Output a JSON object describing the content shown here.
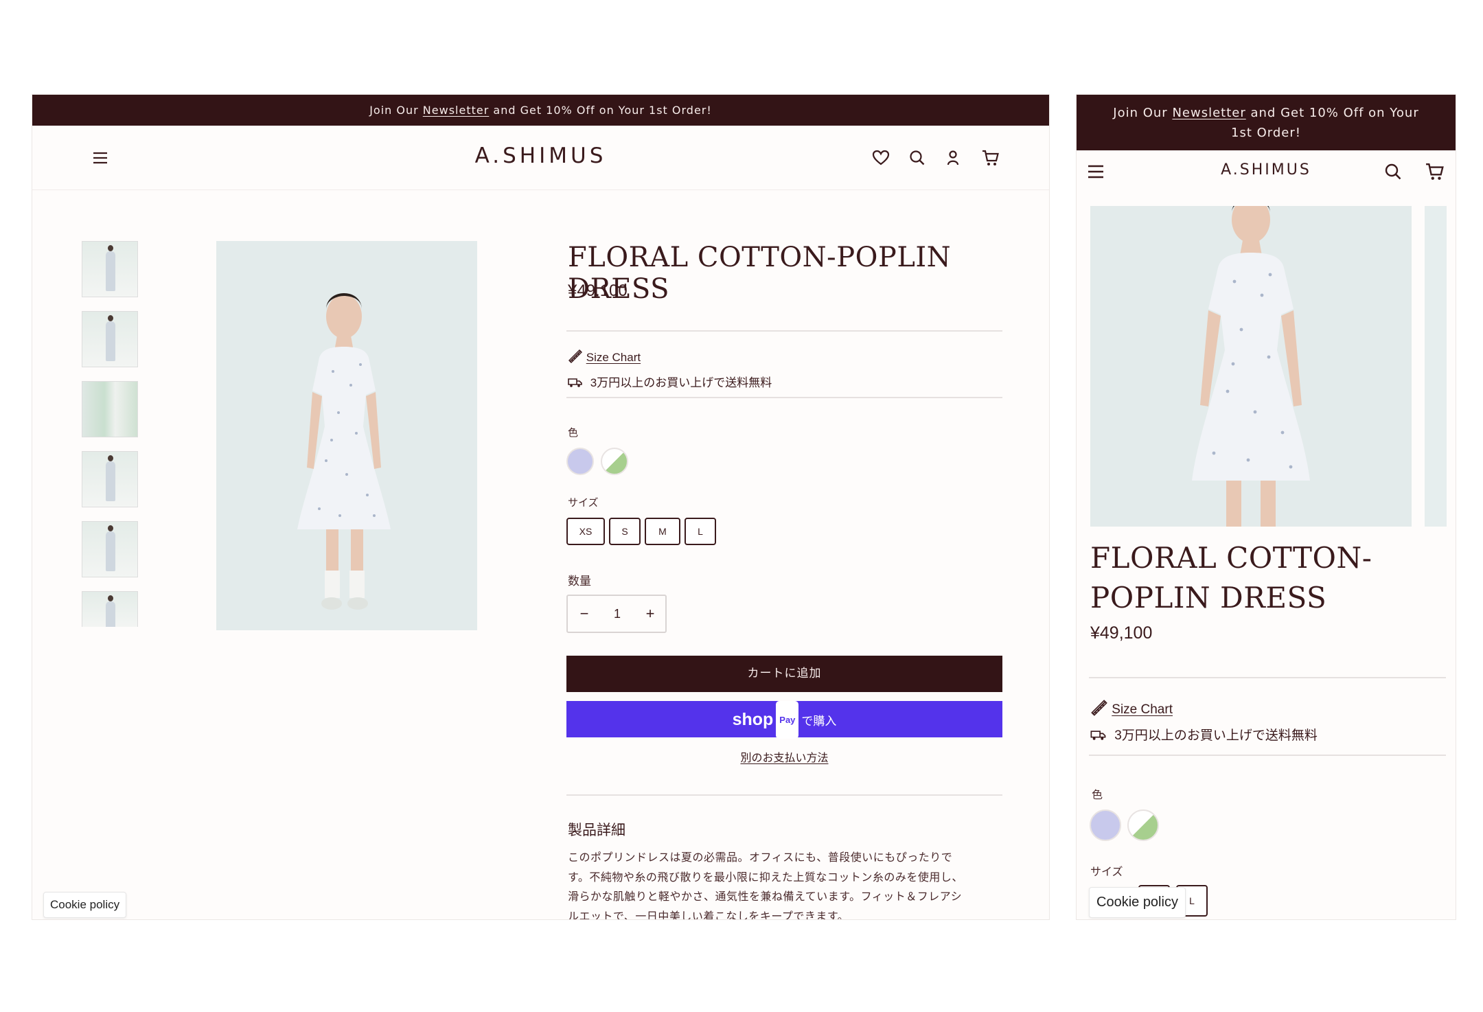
{
  "announcement": {
    "prefix": "Join Our",
    "link": "Newsletter",
    "suffix": "and Get 10% Off on Your 1st Order!"
  },
  "brand": {
    "logo": "A.SHIMUS"
  },
  "header_icons": {
    "menu": "hamburger-menu-icon",
    "wishlist": "heart-icon",
    "search": "search-icon",
    "account": "account-icon",
    "cart": "cart-icon"
  },
  "product": {
    "title": "FLORAL COTTON-POPLIN DRESS",
    "title_line1": "FLORAL COTTON-",
    "title_line2": "POPLIN DRESS",
    "price": "¥49,100",
    "size_chart": "Size Chart",
    "shipping_note": "3万円以上のお買い上げで送料無料",
    "color_label": "色",
    "colors": [
      "lavender",
      "green-white"
    ],
    "size_label": "サイズ",
    "sizes": [
      "XS",
      "S",
      "M",
      "L"
    ],
    "quantity_label": "数量",
    "quantity": "1",
    "qty_minus": "−",
    "qty_plus": "+",
    "add_to_cart": "カートに追加",
    "shop_pay_word": "shop",
    "shop_pay_badge": "Pay",
    "shop_pay_suffix": "で購入",
    "other_payment": "別のお支払い方法",
    "details_title": "製品詳細",
    "details_lines": [
      "このポプリンドレスは夏の必需品。オフィスにも、普段使いにもぴったりで",
      "す。不純物や糸の飛び散りを最小限に抑えた上質なコットン糸のみを使用し、",
      "滑らかな肌触りと軽やかさ、通気性を兼ね備えています。フィット＆フレアシ",
      "ルエットで、一日中美しい着こなしをキープできます。"
    ]
  },
  "cookie": {
    "label": "Cookie policy"
  },
  "colors": {
    "dark_brown": "#331416",
    "shop_pay_purple": "#5433eb",
    "swatch_lavender": "#c8c9ec",
    "swatch_green": "#a7cf8e"
  }
}
